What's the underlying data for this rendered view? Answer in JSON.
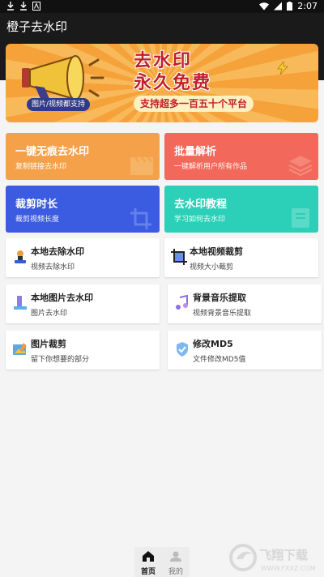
{
  "status_bar": {
    "time": "2:07"
  },
  "app": {
    "title": "橙子去水印"
  },
  "banner": {
    "headline_1": "去水印",
    "headline_2": "永久免费",
    "pill": "图片/视频都支持",
    "support": "支持超多一百五十个平台"
  },
  "feature_cards": [
    {
      "title": "一键无痕去水印",
      "subtitle": "复制链接去水印",
      "color": "#f5a14a"
    },
    {
      "title": "批量解析",
      "subtitle": "一键解析用户所有作品",
      "color": "#f2685a"
    },
    {
      "title": "裁剪时长",
      "subtitle": "裁剪视频长度",
      "color": "#3b5be0"
    },
    {
      "title": "去水印教程",
      "subtitle": "学习如何去水印",
      "color": "#2ccfb8"
    }
  ],
  "tools": [
    {
      "title": "本地去除水印",
      "subtitle": "视频去除水印"
    },
    {
      "title": "本地视频裁剪",
      "subtitle": "视频大小裁剪"
    },
    {
      "title": "本地图片去水印",
      "subtitle": "图片去水印"
    },
    {
      "title": "背景音乐提取",
      "subtitle": "视频背景音乐提取"
    },
    {
      "title": "图片裁剪",
      "subtitle": "留下你想要的部分"
    },
    {
      "title": "修改MD5",
      "subtitle": "文件修改MD5值"
    }
  ],
  "bottom_nav": {
    "home": "首页",
    "mine": "我的"
  },
  "watermark": {
    "text": "飞翔下载",
    "url": "WWW.FXXZ.COM"
  }
}
